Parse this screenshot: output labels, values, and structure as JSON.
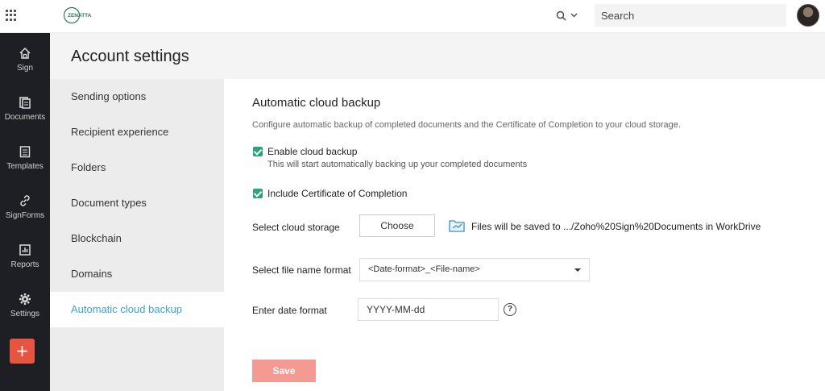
{
  "topbar": {
    "logo_text": "ZENATTA",
    "search_placeholder": "Search",
    "icons": {
      "apps": "grid-icon",
      "search": "search-icon",
      "dropdown": "chevron-down-icon"
    }
  },
  "leftnav": {
    "items": [
      {
        "label": "Sign",
        "icon": "home-icon"
      },
      {
        "label": "Documents",
        "icon": "documents-icon"
      },
      {
        "label": "Templates",
        "icon": "templates-icon"
      },
      {
        "label": "SignForms",
        "icon": "link-icon"
      },
      {
        "label": "Reports",
        "icon": "reports-icon"
      },
      {
        "label": "Settings",
        "icon": "gear-icon"
      }
    ],
    "add_label": "+"
  },
  "page": {
    "title": "Account settings"
  },
  "settings_menu": {
    "items": [
      {
        "label": "Sending options"
      },
      {
        "label": "Recipient experience"
      },
      {
        "label": "Folders"
      },
      {
        "label": "Document types"
      },
      {
        "label": "Blockchain"
      },
      {
        "label": "Domains"
      },
      {
        "label": "Automatic cloud backup"
      }
    ],
    "active_index": 6
  },
  "content": {
    "title": "Automatic cloud backup",
    "description": "Configure automatic backup of completed documents and the Certificate of Completion to your cloud storage.",
    "enable_backup": {
      "label": "Enable cloud backup",
      "sublabel": "This will start automatically backing up your completed documents",
      "checked": true
    },
    "include_certificate": {
      "label": "Include Certificate of Completion",
      "checked": true
    },
    "cloud_storage": {
      "label": "Select cloud storage",
      "button": "Choose",
      "save_path": "Files will be saved to .../Zoho%20Sign%20Documents in WorkDrive"
    },
    "file_name_format": {
      "label": "Select file name format",
      "value": "<Date-format>_<File-name>"
    },
    "date_format": {
      "label": "Enter date format",
      "value": "YYYY-MM-dd",
      "help": "?"
    },
    "save_button": "Save"
  },
  "colors": {
    "accent": "#3aa4d8",
    "checkbox": "#28a37c",
    "save": "#f49a93",
    "nav_bg": "#1e1f24",
    "add": "#e7543f"
  }
}
